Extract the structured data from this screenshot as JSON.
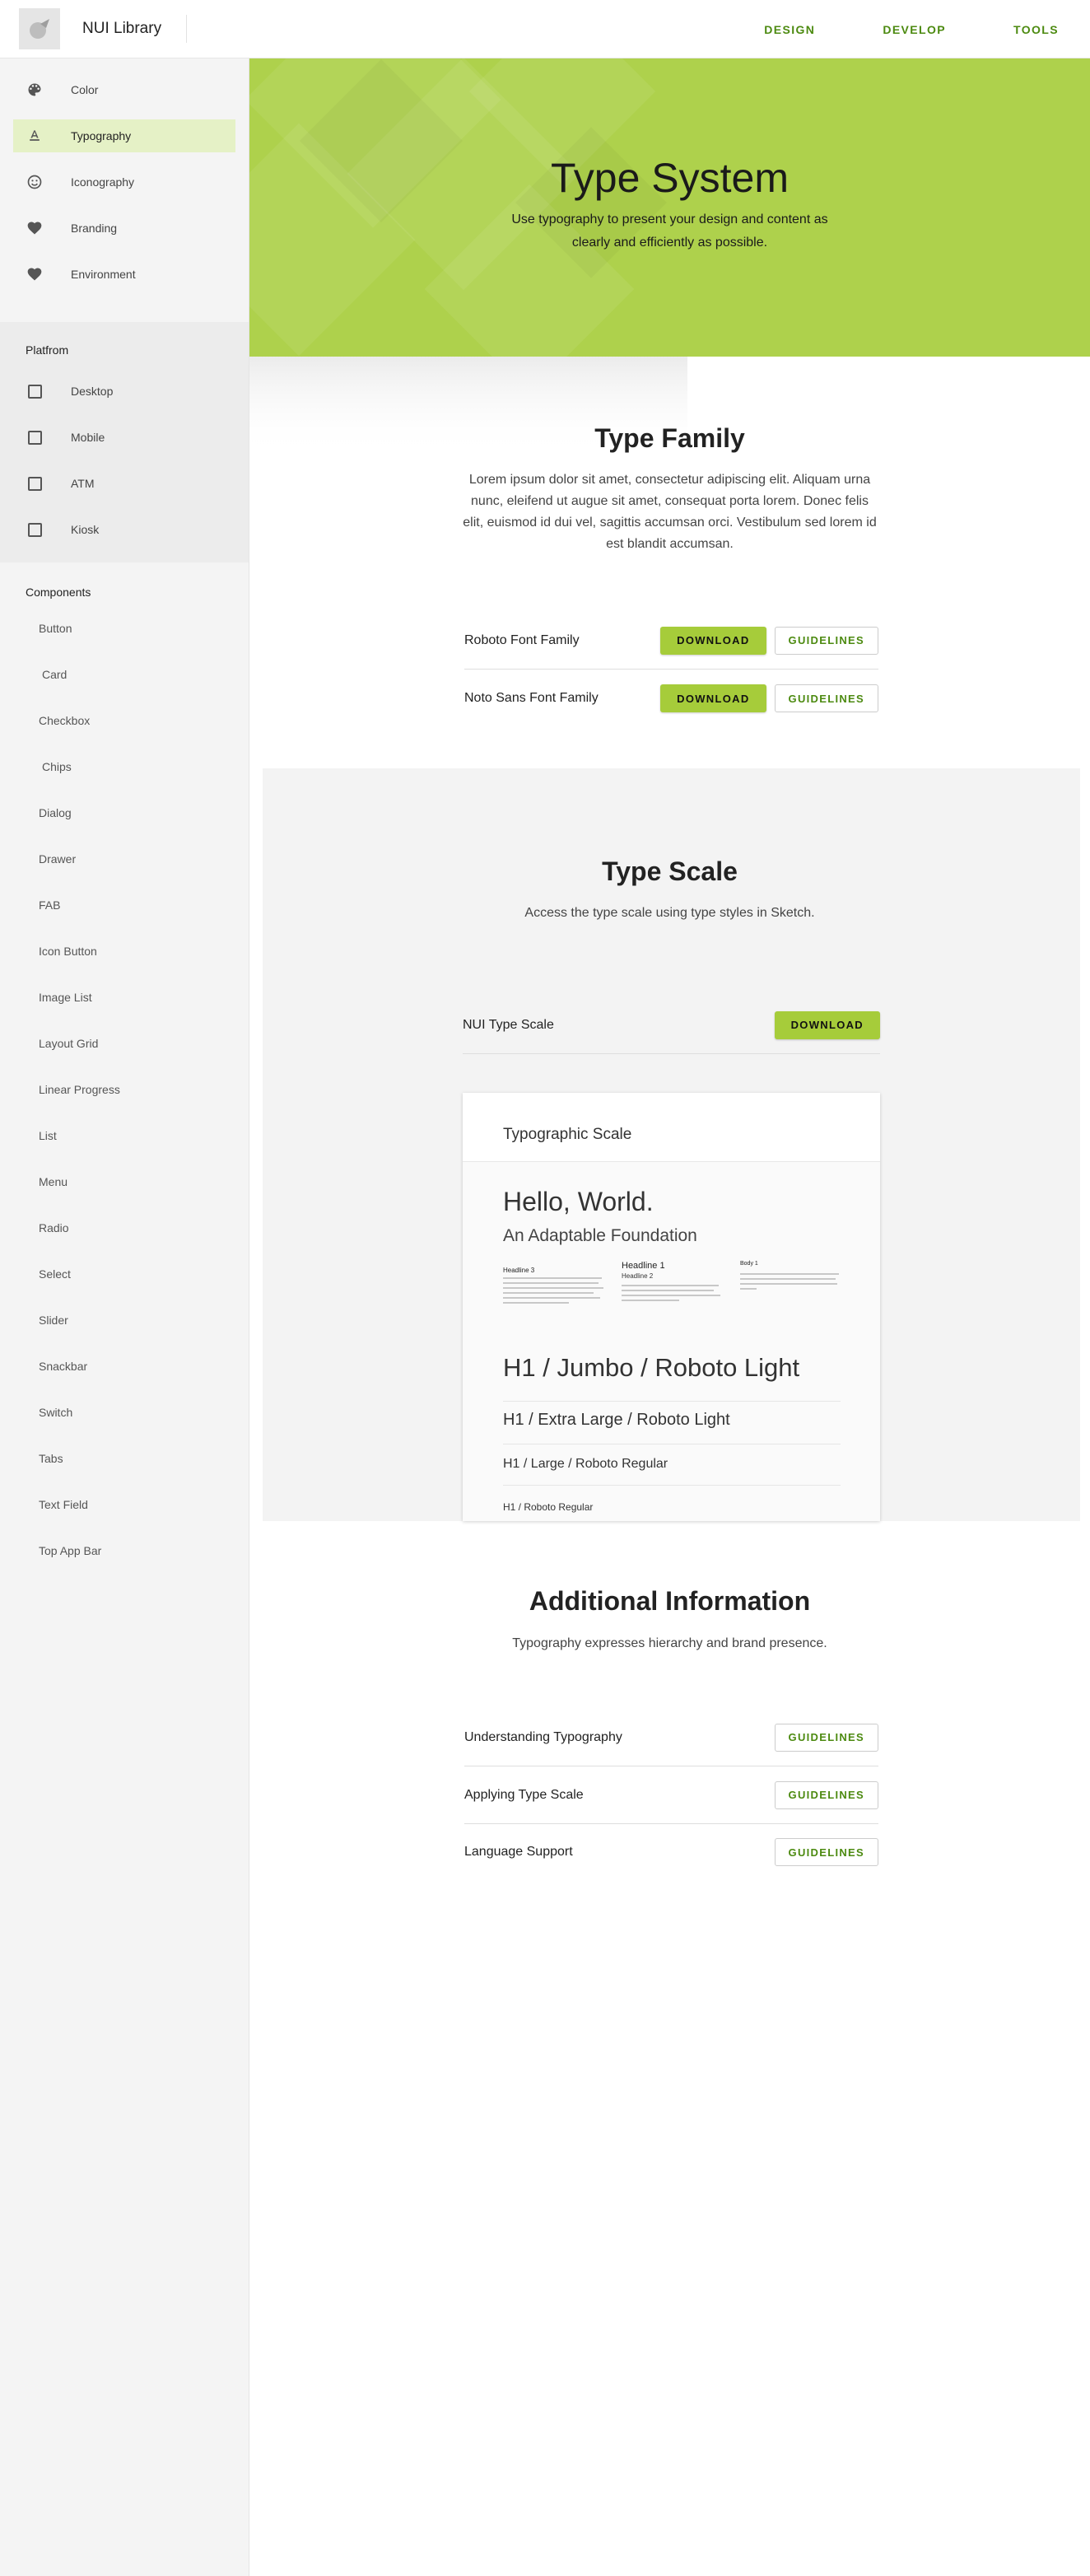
{
  "topbar": {
    "app_title": "NUI Library",
    "nav": [
      "DESIGN",
      "DEVELOP",
      "TOOLS"
    ]
  },
  "sidebar": {
    "items": [
      {
        "label": "Color",
        "icon": "palette-icon"
      },
      {
        "label": "Typography",
        "icon": "text-format-icon",
        "active": true
      },
      {
        "label": "Iconography",
        "icon": "smiley-icon"
      },
      {
        "label": "Branding",
        "icon": "heart-icon"
      },
      {
        "label": "Environment",
        "icon": "heart-icon"
      }
    ],
    "platform_heading": "Platfrom",
    "platform_items": [
      "Desktop",
      "Mobile",
      "ATM",
      "Kiosk"
    ],
    "components_heading": "Components",
    "components": [
      "Button",
      "Card",
      "Checkbox",
      "Chips",
      "Dialog",
      "Drawer",
      "FAB",
      "Icon Button",
      "Image List",
      "Layout Grid",
      "Linear Progress",
      "List",
      "Menu",
      "Radio",
      "Select",
      "Slider",
      "Snackbar",
      "Switch",
      "Tabs",
      "Text Field",
      "Top App Bar"
    ]
  },
  "hero": {
    "title": "Type System",
    "subtitle": "Use typography to present your design and content as clearly and efficiently as possible.",
    "color": "#aed14c"
  },
  "type_family": {
    "title": "Type Family",
    "text": "Lorem ipsum dolor sit amet, consectetur adipiscing elit. Aliquam urna nunc, eleifend ut augue sit amet, consequat porta lorem. Donec felis elit, euismod id dui vel, sagittis accumsan orci. Vestibulum sed lorem id est blandit accumsan.",
    "rows": [
      {
        "label": "Roboto Font Family",
        "download": "DOWNLOAD",
        "guidelines": "GUIDELINES"
      },
      {
        "label": "Noto Sans Font Family",
        "download": "DOWNLOAD",
        "guidelines": "GUIDELINES"
      }
    ]
  },
  "type_scale": {
    "title": "Type Scale",
    "text": "Access the type scale using type styles in Sketch.",
    "row_label": "NUI Type Scale",
    "download": "DOWNLOAD",
    "preview": {
      "header": "Typographic Scale",
      "hello": "Hello, World.",
      "adaptable": "An Adaptable Foundation",
      "col1_title": "Headline 3",
      "col2_title": "Headline 1",
      "col2_sub": "Headline 2",
      "col3_title": "Body 1",
      "h1_jumbo": "H1 / Jumbo / Roboto Light",
      "h1_xl": "H1 / Extra Large / Roboto Light",
      "h1_large": "H1 / Large / Roboto Regular",
      "h1_regular": "H1 / Roboto Regular"
    }
  },
  "additional": {
    "title": "Additional Information",
    "text": "Typography expresses hierarchy and brand presence.",
    "rows": [
      {
        "label": "Understanding Typography",
        "guidelines": "GUIDELINES"
      },
      {
        "label": "Applying Type Scale",
        "guidelines": "GUIDELINES"
      },
      {
        "label": "Language Support",
        "guidelines": "GUIDELINES"
      }
    ]
  },
  "colors": {
    "accent": "#a6cc3a",
    "link": "#4c8a10"
  }
}
